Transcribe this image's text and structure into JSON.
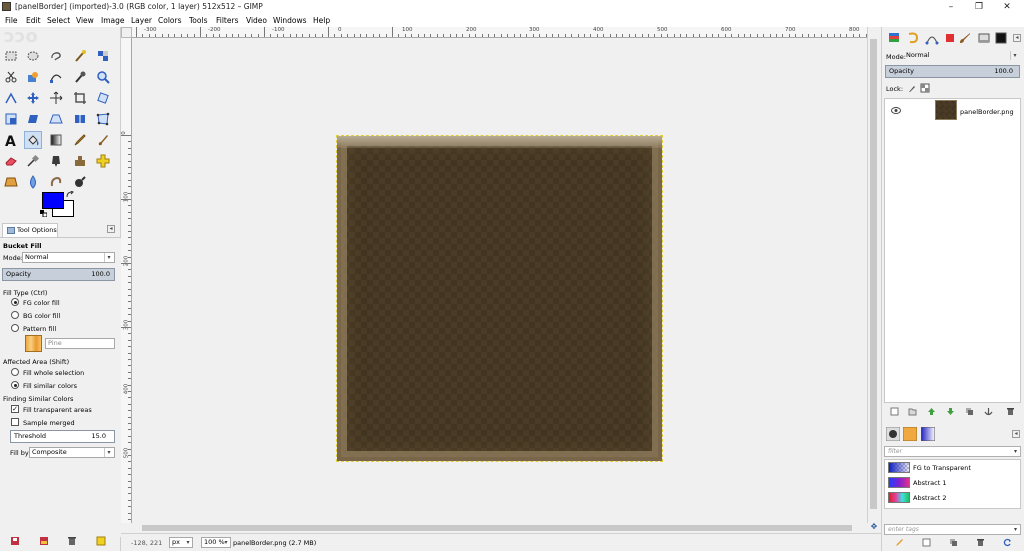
{
  "window": {
    "title": "[panelBorder] (imported)-3.0 (RGB color, 1 layer) 512x512 – GIMP",
    "minimize": "–",
    "maximize": "❐",
    "close": "✕"
  },
  "menu": [
    "File",
    "Edit",
    "Select",
    "View",
    "Image",
    "Layer",
    "Colors",
    "Tools",
    "Filters",
    "Video",
    "Windows",
    "Help"
  ],
  "toolbox": {
    "active_tool": "bucket-fill",
    "fg_color": "#0000ff",
    "bg_color": "#ffffff"
  },
  "tool_options": {
    "tab_label": "Tool Options",
    "tool_name": "Bucket Fill",
    "mode_label": "Mode:",
    "mode_value": "Normal",
    "opacity_label": "Opacity",
    "opacity_value": "100.0",
    "fill_type_label": "Fill Type  (Ctrl)",
    "fill_types": [
      "FG color fill",
      "BG color fill",
      "Pattern fill"
    ],
    "pattern_name": "Pine",
    "affected_area_label": "Affected Area  (Shift)",
    "affected_areas": [
      "Fill whole selection",
      "Fill similar colors"
    ],
    "finding_label": "Finding Similar Colors",
    "fill_transparent": "Fill transparent areas",
    "sample_merged": "Sample merged",
    "threshold_label": "Threshold",
    "threshold_value": "15.0",
    "fill_by_label": "Fill by:",
    "fill_by_value": "Composite"
  },
  "rulers": {
    "h_labels": [
      "-300",
      "-200",
      "-100",
      "0",
      "100",
      "200",
      "300",
      "400",
      "500",
      "600",
      "700",
      "800"
    ],
    "v_labels": [
      "0",
      "100",
      "200",
      "300",
      "400",
      "500"
    ]
  },
  "status": {
    "coords": "-128, 221",
    "unit": "px",
    "zoom": "100 %",
    "file_info": "panelBorder.png (2.7 MB)"
  },
  "layers": {
    "mode_label": "Mode:",
    "mode_value": "Normal",
    "opacity_label": "Opacity",
    "opacity_value": "100.0",
    "lock_label": "Lock:",
    "items": [
      {
        "name": "panelBorder.png"
      }
    ]
  },
  "gradients": {
    "filter_placeholder": "filter",
    "items": [
      {
        "name": "FG to Transparent"
      },
      {
        "name": "Abstract 1"
      },
      {
        "name": "Abstract 2"
      }
    ],
    "tags_placeholder": "enter tags"
  }
}
